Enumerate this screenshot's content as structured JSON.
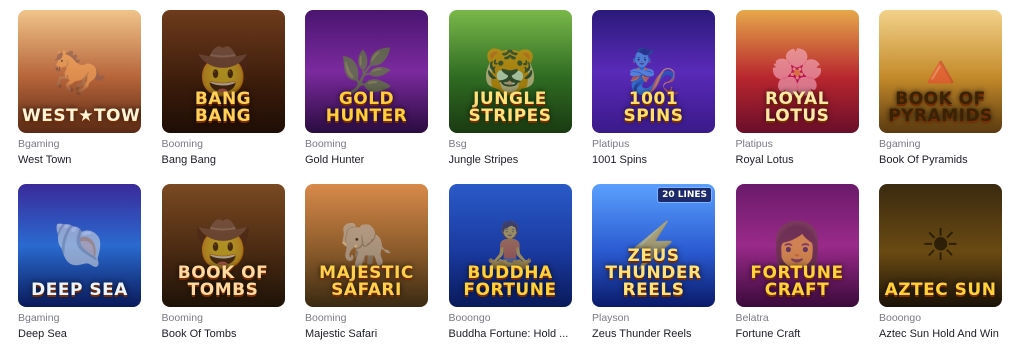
{
  "games": [
    {
      "provider": "Bgaming",
      "title": "West Town",
      "logo": "West★Town",
      "art": "🐎",
      "bg": "linear-gradient(180deg,#f0c48a 0%,#b6643a 55%,#5a2a14 100%)",
      "logo_color": "#fff3d6"
    },
    {
      "provider": "Booming",
      "title": "Bang Bang",
      "logo": "Bang Bang",
      "art": "🤠",
      "bg": "linear-gradient(180deg,#6e3b1c 0%,#3b1c0b 60%,#1e0d05 100%)",
      "logo_color": "#ffd257"
    },
    {
      "provider": "Booming",
      "title": "Gold Hunter",
      "logo": "Gold Hunter",
      "art": "🌿",
      "bg": "linear-gradient(180deg,#4a1570 0%,#7b2a9e 50%,#2a0c40 100%)",
      "logo_color": "#ffcf3a"
    },
    {
      "provider": "Bsg",
      "title": "Jungle Stripes",
      "logo": "Jungle Stripes",
      "art": "🐯",
      "bg": "linear-gradient(180deg,#7ab84a 0%,#2f6b22 55%,#1a3a12 100%)",
      "logo_color": "#ffe27a"
    },
    {
      "provider": "Platipus",
      "title": "1001 Spins",
      "logo": "1001 Spins",
      "art": "🧞",
      "bg": "linear-gradient(180deg,#2a1a7a 0%,#5a2ab8 50%,#3a1a8a 100%)",
      "logo_color": "#ffe066"
    },
    {
      "provider": "Platipus",
      "title": "Royal Lotus",
      "logo": "Royal Lotus",
      "art": "🌸",
      "bg": "linear-gradient(180deg,#e6a84a 0%,#b8262e 55%,#6a0e2a 100%)",
      "logo_color": "#ffe9a6"
    },
    {
      "provider": "Bgaming",
      "title": "Book Of Pyramids",
      "logo": "Book of Pyramids",
      "art": "🔺",
      "bg": "linear-gradient(180deg,#f2d28a 0%,#c48a2a 55%,#5a3a10 100%)",
      "logo_color": "#3a2206"
    },
    {
      "provider": "Bgaming",
      "title": "Deep Sea",
      "logo": "Deep Sea",
      "art": "🐚",
      "bg": "linear-gradient(180deg,#3a2a9a 0%,#2a6ad0 50%,#0a1a5a 100%)",
      "logo_color": "#eaf6ff"
    },
    {
      "provider": "Booming",
      "title": "Book Of Tombs",
      "logo": "Book of Tombs",
      "art": "🤠",
      "bg": "linear-gradient(180deg,#7a4a22 0%,#4a2a12 55%,#1e1208 100%)",
      "logo_color": "#ffd9a0"
    },
    {
      "provider": "Booming",
      "title": "Majestic Safari",
      "logo": "Majestic Safari",
      "art": "🐘",
      "bg": "linear-gradient(180deg,#d88a4a 0%,#8a5a2a 55%,#3a2a12 100%)",
      "logo_color": "#ffd04a"
    },
    {
      "provider": "Booongo",
      "title": "Buddha Fortune: Hold ...",
      "logo": "Buddha Fortune",
      "art": "🧘",
      "bg": "linear-gradient(180deg,#2a5ac8 0%,#1a3aa0 55%,#0a1a5a 100%)",
      "logo_color": "#ffd23a"
    },
    {
      "provider": "Playson",
      "title": "Zeus Thunder Reels",
      "logo": "Zeus Thunder Reels",
      "art": "⚡",
      "bg": "linear-gradient(180deg,#5aa0ff 0%,#2a5ad0 55%,#0a1a6a 100%)",
      "logo_color": "#ffe27a",
      "badge": "20 LINES"
    },
    {
      "provider": "Belatra",
      "title": "Fortune Craft",
      "logo": "Fortune Craft",
      "art": "👩",
      "bg": "linear-gradient(180deg,#6a1a6a 0%,#9a2a8a 50%,#3a0a3a 100%)",
      "logo_color": "#ffd23a"
    },
    {
      "provider": "Booongo",
      "title": "Aztec Sun Hold And Win",
      "logo": "Aztec Sun",
      "art": "☀",
      "bg": "linear-gradient(180deg,#3a2a10 0%,#6a4a12 55%,#1a1208 100%)",
      "logo_color": "#ffd23a"
    }
  ]
}
